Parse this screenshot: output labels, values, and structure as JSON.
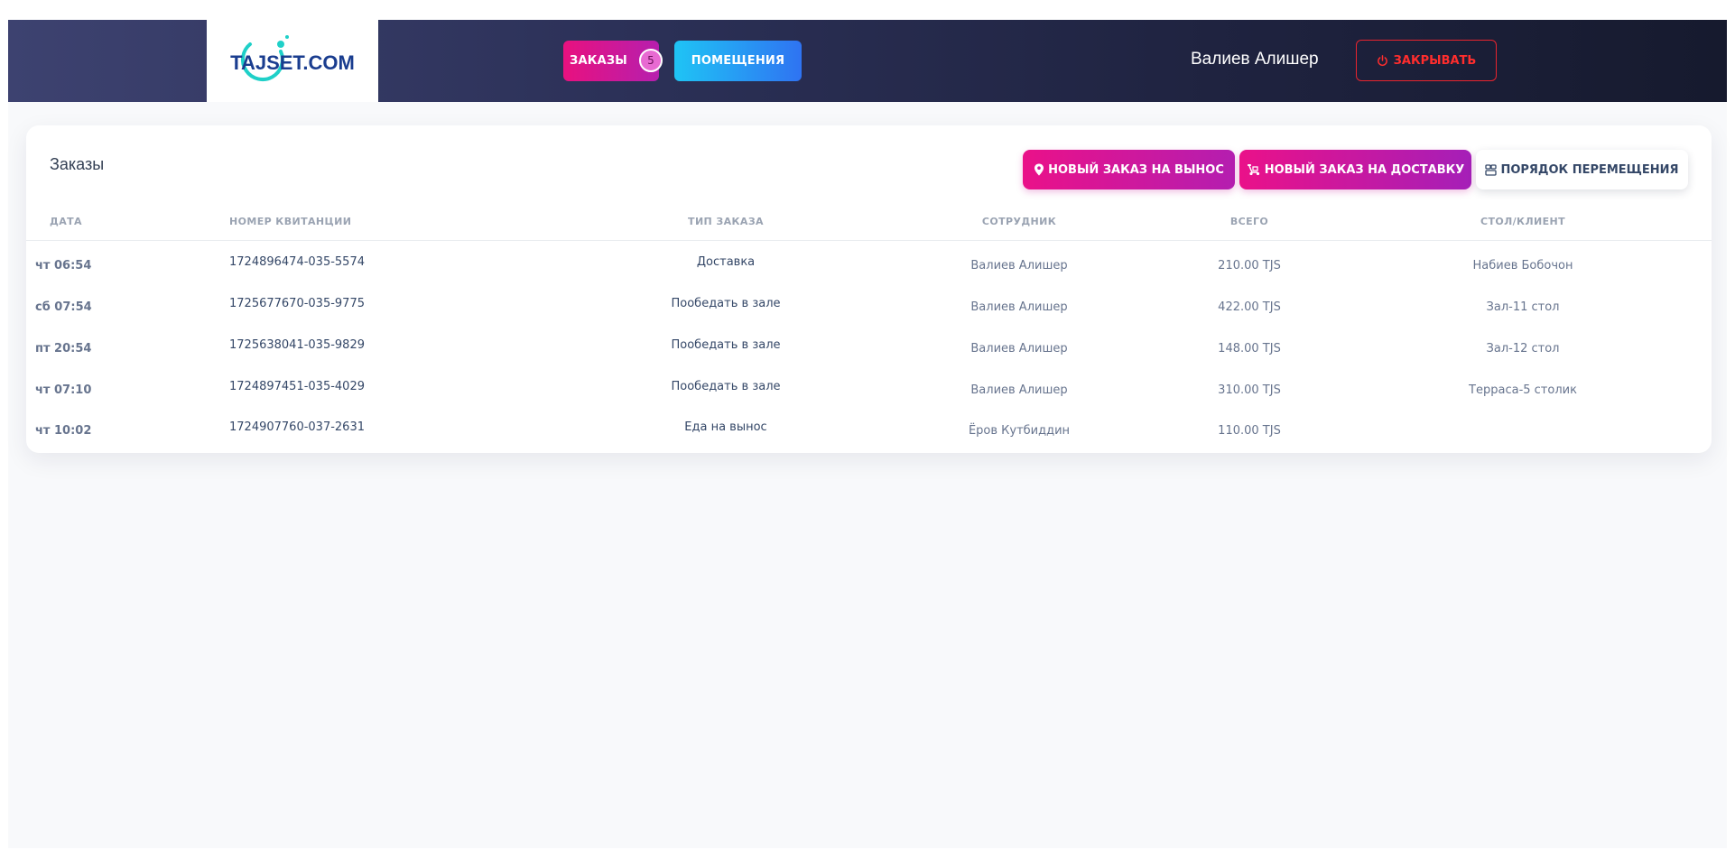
{
  "header": {
    "logo_text": "TAJSET.COM",
    "nav": [
      {
        "label": "ЗАКАЗЫ",
        "badge": "5"
      },
      {
        "label": "ПОМЕЩЕНИЯ"
      }
    ],
    "user_name": "Валиев Алишер",
    "close_label": "ЗАКРЫВАТЬ"
  },
  "orders": {
    "title": "Заказы",
    "actions": {
      "takeaway": "НОВЫЙ ЗАКАЗ НА ВЫНОС",
      "delivery": "НОВЫЙ ЗАКАЗ НА ДОСТАВКУ",
      "move": "ПОРЯДОК ПЕРЕМЕЩЕНИЯ"
    },
    "columns": [
      "ДАТА",
      "НОМЕР КВИТАНЦИИ",
      "ТИП ЗАКАЗА",
      "СОТРУДНИК",
      "ВСЕГО",
      "СТОЛ/КЛИЕНТ"
    ],
    "rows": [
      {
        "date": "чт 06:54",
        "receipt": "1724896474-035-5574",
        "type": "Доставка",
        "staff": "Валиев Алишер",
        "total": "210.00 TJS",
        "table": "Набиев Бобочон"
      },
      {
        "date": "сб 07:54",
        "receipt": "1725677670-035-9775",
        "type": "Пообедать в зале",
        "staff": "Валиев Алишер",
        "total": "422.00 TJS",
        "table": "Зал-11 стол"
      },
      {
        "date": "пт 20:54",
        "receipt": "1725638041-035-9829",
        "type": "Пообедать в зале",
        "staff": "Валиев Алишер",
        "total": "148.00 TJS",
        "table": "Зал-12 стол"
      },
      {
        "date": "чт 07:10",
        "receipt": "1724897451-035-4029",
        "type": "Пообедать в зале",
        "staff": "Валиев Алишер",
        "total": "310.00 TJS",
        "table": "Терраса-5 столик"
      },
      {
        "date": "чт 10:02",
        "receipt": "1724907760-037-2631",
        "type": "Еда на вынос",
        "staff": "Ёров Кутбиддин",
        "total": "110.00 TJS",
        "table": ""
      }
    ]
  },
  "colors": {
    "accent_pink": "#e8117f",
    "accent_purple": "#b61fae",
    "accent_blue": "#2f73f2",
    "danger": "#ff2d2d"
  }
}
